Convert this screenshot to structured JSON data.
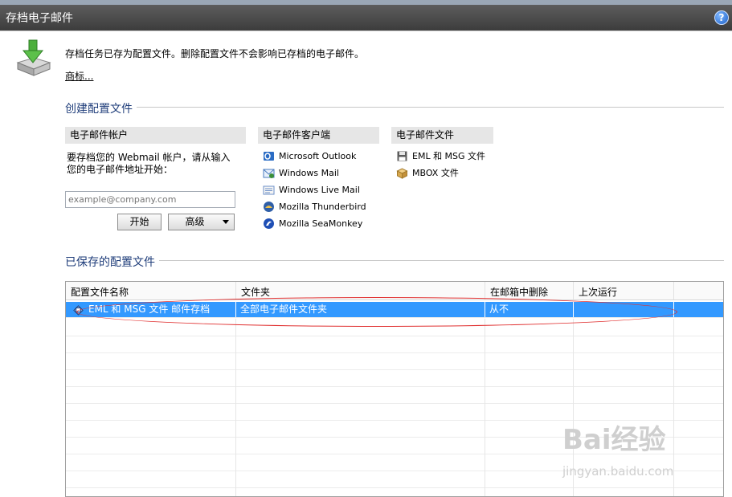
{
  "window": {
    "title": "存档电子邮件",
    "help_label": "?"
  },
  "intro": {
    "text": "存档任务已存为配置文件。删除配置文件不会影响已存档的电子邮件。",
    "trademark_link": "商标..."
  },
  "create_section": {
    "heading": "创建配置文件",
    "email_account": {
      "header": "电子邮件帐户",
      "description": "要存档您的 Webmail 帐户，请从输入您的电子邮件地址开始：",
      "input_placeholder": "example@company.com",
      "start_button": "开始",
      "advanced_button": "高级"
    },
    "clients": {
      "header": "电子邮件客户端",
      "items": [
        {
          "label": "Microsoft Outlook",
          "icon": "outlook-icon"
        },
        {
          "label": "Windows Mail",
          "icon": "windows-mail-icon"
        },
        {
          "label": "Windows Live Mail",
          "icon": "windows-live-mail-icon"
        },
        {
          "label": "Mozilla Thunderbird",
          "icon": "thunderbird-icon"
        },
        {
          "label": "Mozilla SeaMonkey",
          "icon": "seamonkey-icon"
        }
      ]
    },
    "files": {
      "header": "电子邮件文件",
      "items": [
        {
          "label": "EML 和 MSG 文件",
          "icon": "floppy-disk-icon"
        },
        {
          "label": "MBOX 文件",
          "icon": "box-icon"
        }
      ]
    }
  },
  "saved_section": {
    "heading": "已保存的配置文件",
    "columns": [
      "配置文件名称",
      "文件夹",
      "在邮箱中删除",
      "上次运行"
    ],
    "rows": [
      {
        "name": "EML 和 MSG 文件 邮件存档",
        "folder": "全部电子邮件文件夹",
        "delete_in_mailbox": "从不",
        "last_run": ""
      }
    ]
  },
  "watermark": {
    "text": "Bai经验",
    "sub": "jingyan.baidu.com"
  },
  "colors": {
    "section_heading": "#1f3d7a",
    "selection": "#3399ff",
    "highlight_ellipse": "#e03030"
  }
}
